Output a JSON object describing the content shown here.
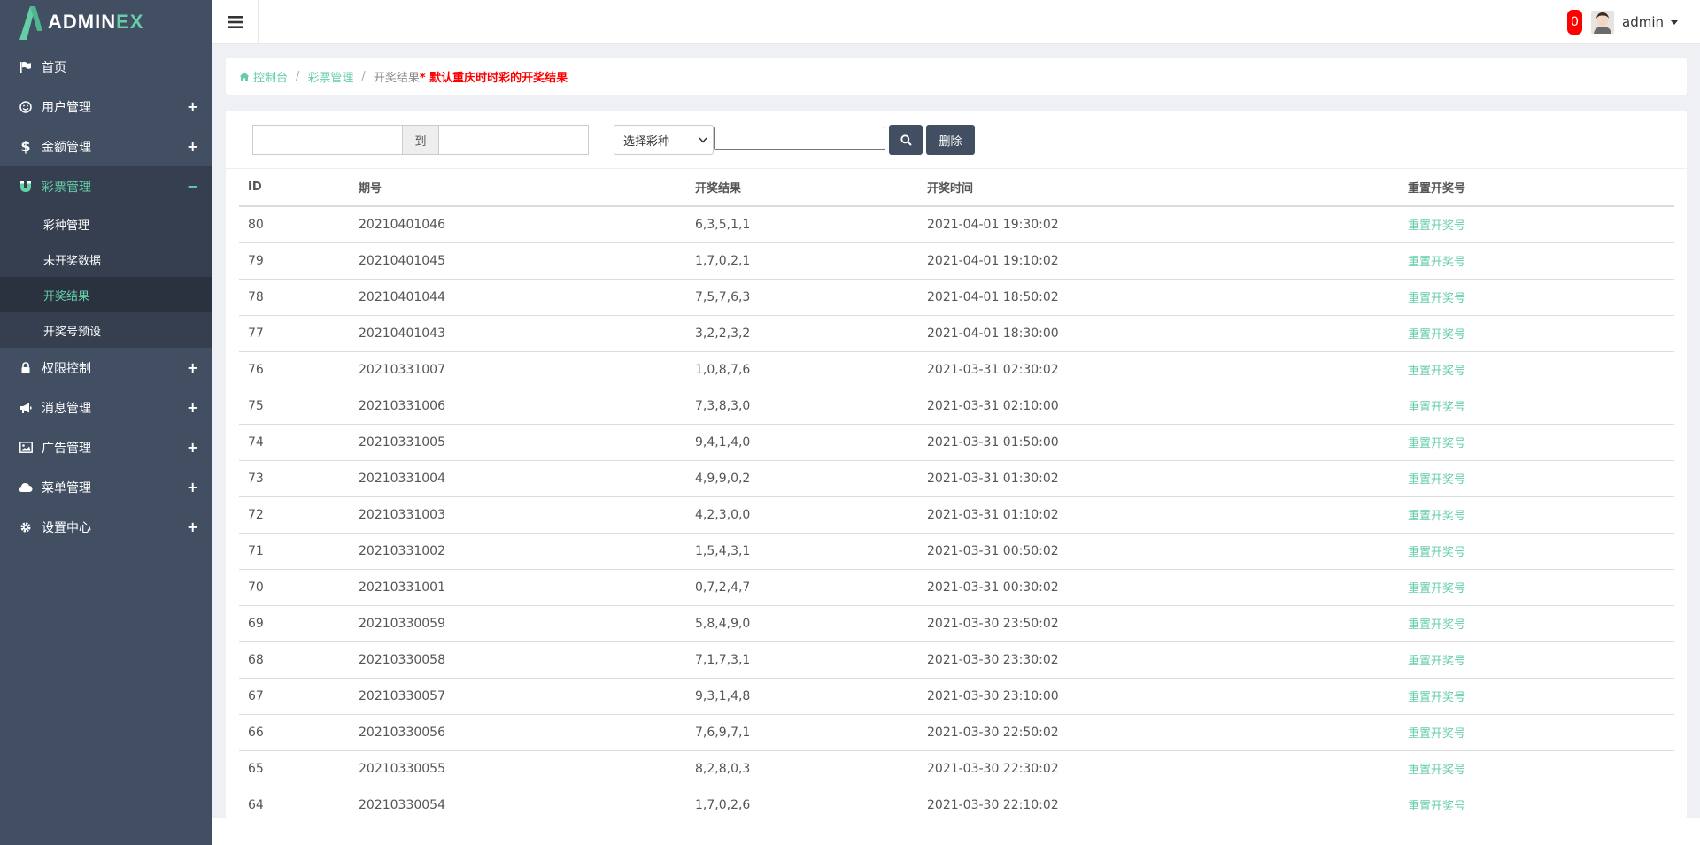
{
  "brand": {
    "main": "ADMIN",
    "accent": "EX"
  },
  "colors": {
    "accent": "#65cea7",
    "sidebar": "#424f63",
    "sidebar_dark": "#353f4f",
    "danger": "#ff0000"
  },
  "sidebar": {
    "items": [
      {
        "label": "首页",
        "icon": "flag-icon",
        "expand": ""
      },
      {
        "label": "用户管理",
        "icon": "smile-icon",
        "expand": "+"
      },
      {
        "label": "金额管理",
        "icon": "dollar-icon",
        "expand": "+"
      },
      {
        "label": "彩票管理",
        "icon": "magnet-icon",
        "expand": "−"
      },
      {
        "label": "权限控制",
        "icon": "lock-icon",
        "expand": "+"
      },
      {
        "label": "消息管理",
        "icon": "bullhorn-icon",
        "expand": "+"
      },
      {
        "label": "广告管理",
        "icon": "image-icon",
        "expand": "+"
      },
      {
        "label": "菜单管理",
        "icon": "cloud-icon",
        "expand": "+"
      },
      {
        "label": "设置中心",
        "icon": "gear-icon",
        "expand": "+"
      }
    ],
    "subitems": [
      {
        "label": "彩种管理"
      },
      {
        "label": "未开奖数据"
      },
      {
        "label": "开奖结果"
      },
      {
        "label": "开奖号预设"
      }
    ]
  },
  "header": {
    "badge": "0",
    "username": "admin"
  },
  "breadcrumb": {
    "home": "控制台",
    "parent": "彩票管理",
    "current": "开奖结果",
    "note": "* 默认重庆时时彩的开奖结果"
  },
  "toolbar": {
    "date_sep": "到",
    "select_label": "选择彩种",
    "delete_label": "删除"
  },
  "table": {
    "headers": [
      "ID",
      "期号",
      "开奖结果",
      "开奖时间",
      "重置开奖号"
    ],
    "rows": [
      [
        "80",
        "20210401046",
        "6,3,5,1,1",
        "2021-04-01 19:30:02",
        "重置开奖号"
      ],
      [
        "79",
        "20210401045",
        "1,7,0,2,1",
        "2021-04-01 19:10:02",
        "重置开奖号"
      ],
      [
        "78",
        "20210401044",
        "7,5,7,6,3",
        "2021-04-01 18:50:02",
        "重置开奖号"
      ],
      [
        "77",
        "20210401043",
        "3,2,2,3,2",
        "2021-04-01 18:30:00",
        "重置开奖号"
      ],
      [
        "76",
        "20210331007",
        "1,0,8,7,6",
        "2021-03-31 02:30:02",
        "重置开奖号"
      ],
      [
        "75",
        "20210331006",
        "7,3,8,3,0",
        "2021-03-31 02:10:00",
        "重置开奖号"
      ],
      [
        "74",
        "20210331005",
        "9,4,1,4,0",
        "2021-03-31 01:50:00",
        "重置开奖号"
      ],
      [
        "73",
        "20210331004",
        "4,9,9,0,2",
        "2021-03-31 01:30:02",
        "重置开奖号"
      ],
      [
        "72",
        "20210331003",
        "4,2,3,0,0",
        "2021-03-31 01:10:02",
        "重置开奖号"
      ],
      [
        "71",
        "20210331002",
        "1,5,4,3,1",
        "2021-03-31 00:50:02",
        "重置开奖号"
      ],
      [
        "70",
        "20210331001",
        "0,7,2,4,7",
        "2021-03-31 00:30:02",
        "重置开奖号"
      ],
      [
        "69",
        "20210330059",
        "5,8,4,9,0",
        "2021-03-30 23:50:02",
        "重置开奖号"
      ],
      [
        "68",
        "20210330058",
        "7,1,7,3,1",
        "2021-03-30 23:30:02",
        "重置开奖号"
      ],
      [
        "67",
        "20210330057",
        "9,3,1,4,8",
        "2021-03-30 23:10:00",
        "重置开奖号"
      ],
      [
        "66",
        "20210330056",
        "7,6,9,7,1",
        "2021-03-30 22:50:02",
        "重置开奖号"
      ],
      [
        "65",
        "20210330055",
        "8,2,8,0,3",
        "2021-03-30 22:30:02",
        "重置开奖号"
      ],
      [
        "64",
        "20210330054",
        "1,7,0,2,6",
        "2021-03-30 22:10:02",
        "重置开奖号"
      ]
    ]
  }
}
